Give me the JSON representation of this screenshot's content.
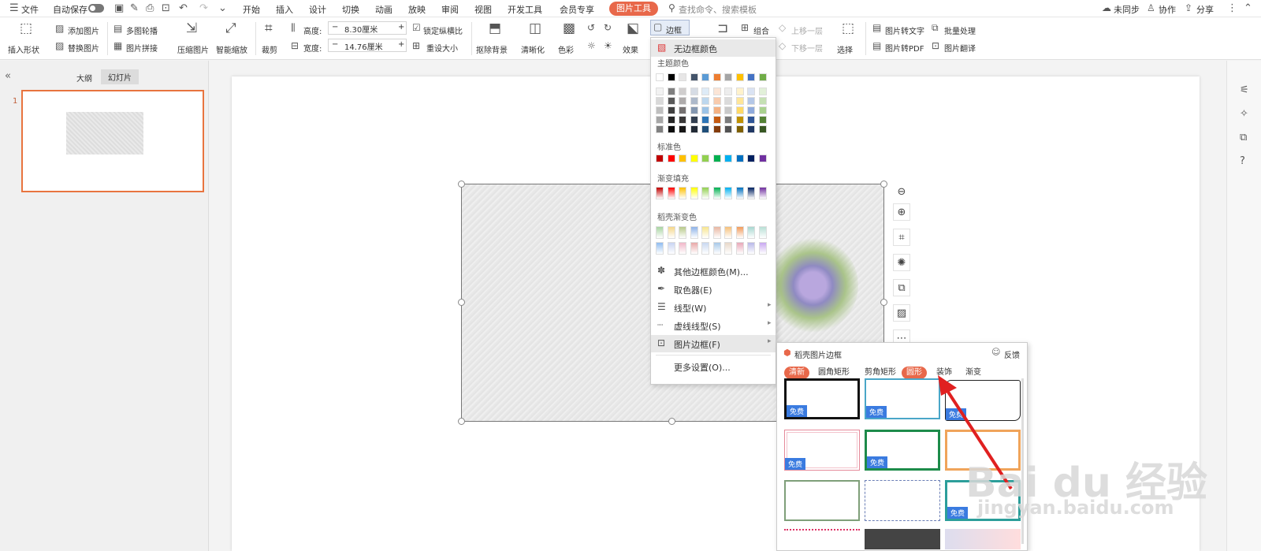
{
  "menubar": {
    "file": "文件",
    "autosave": "自动保存",
    "tabs": [
      "开始",
      "插入",
      "设计",
      "切换",
      "动画",
      "放映",
      "审阅",
      "视图",
      "开发工具",
      "会员专享"
    ],
    "active_tab": "图片工具",
    "search": "查找命令、搜索模板",
    "unsynced": "未同步",
    "collaborate": "协作",
    "share": "分享"
  },
  "ribbon": {
    "insert_shape": "插入形状",
    "add_picture": "添加图片",
    "replace_picture": "替换图片",
    "multi_carousel": "多图轮播",
    "picture_collage": "图片拼接",
    "compress_picture": "压缩图片",
    "smart_zoom": "智能缩放",
    "crop": "裁剪",
    "height_label": "高度:",
    "height_value": "8.30厘米",
    "width_label": "宽度:",
    "width_value": "14.76厘米",
    "lock_aspect": "锁定纵横比",
    "reset_size": "重设大小",
    "remove_bg": "抠除背景",
    "sharpen": "清晰化",
    "color": "色彩",
    "effect": "效果",
    "border": "边框",
    "group": "组合",
    "bring_forward": "上移一层",
    "send_backward": "下移一层",
    "select": "选择",
    "pic_to_text": "图片转文字",
    "batch": "批量处理",
    "pic_to_pdf": "图片转PDF",
    "pic_translate": "图片翻译"
  },
  "left_panel": {
    "outline": "大纲",
    "slides": "幻灯片",
    "slide_number": "1"
  },
  "border_menu": {
    "no_border": "无边框颜色",
    "theme_colors": "主题颜色",
    "standard_colors": "标准色",
    "gradient_fill": "渐变填充",
    "shell_gradient": "稻壳渐变色",
    "items": [
      {
        "label": "其他边框颜色(M)...",
        "icon": "palette-icon"
      },
      {
        "label": "取色器(E)",
        "icon": "eyedropper-icon"
      },
      {
        "label": "线型(W)",
        "icon": "line-style-icon"
      },
      {
        "label": "虚线线型(S)",
        "icon": "dash-style-icon"
      },
      {
        "label": "图片边框(F)",
        "icon": "picture-frame-icon"
      },
      {
        "label": "更多设置(O)...",
        "icon": ""
      }
    ],
    "theme_top": [
      "#ffffff",
      "#000000",
      "#e7e6e6",
      "#44546a",
      "#5b9bd5",
      "#ed7d31",
      "#a5a5a5",
      "#ffc000",
      "#4472c4",
      "#70ad47"
    ],
    "standard": [
      "#c00000",
      "#ff0000",
      "#ffc000",
      "#ffff00",
      "#92d050",
      "#00b050",
      "#00b0f0",
      "#0070c0",
      "#002060",
      "#7030a0"
    ]
  },
  "frame_panel": {
    "title": "稻壳图片边框",
    "feedback": "反馈",
    "tabs": [
      "清新",
      "圆角矩形",
      "剪角矩形",
      "圆形",
      "装饰",
      "渐变"
    ],
    "free_badge": "免费"
  },
  "watermark": {
    "brand": "Bai du 经验",
    "url": "jingyan.baidu.com"
  }
}
